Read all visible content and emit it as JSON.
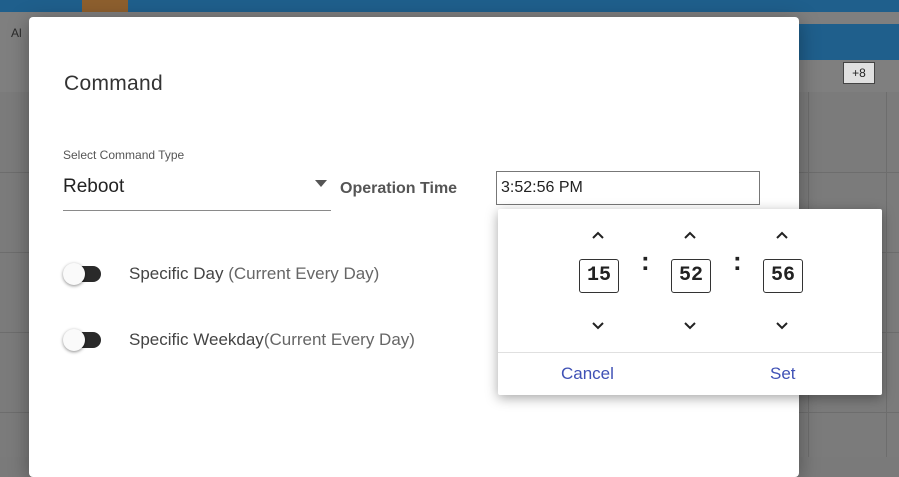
{
  "background": {
    "label_fragment": "Al",
    "badge": "+8"
  },
  "dialog": {
    "title": "Command",
    "command_type_label": "Select Command Type",
    "command_type_value": "Reboot",
    "operation_time_label": "Operation Time",
    "operation_time_value": "3:52:56 PM",
    "toggles": [
      {
        "label": "Specific Day",
        "sub": " (Current Every Day)",
        "on": false
      },
      {
        "label": "Specific Weekday",
        "sub": "(Current Every Day)",
        "on": false
      }
    ]
  },
  "time_picker": {
    "hours": "15",
    "minutes": "52",
    "seconds": "56",
    "separator": ":",
    "cancel_label": "Cancel",
    "set_label": "Set",
    "accent_color": "#3f51b5"
  }
}
